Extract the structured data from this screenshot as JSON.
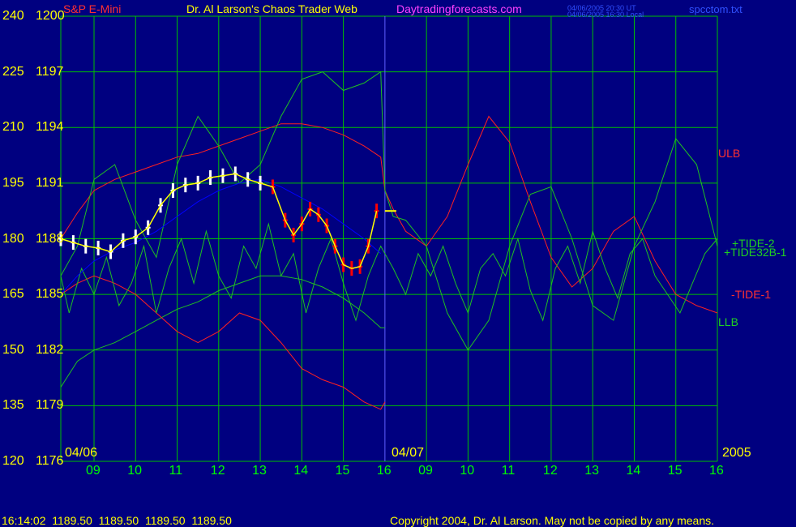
{
  "header": {
    "instrument": "S&P E-Mini",
    "title": "Dr. Al Larson's Chaos Trader Web",
    "site": "Daytradingforecasts.com",
    "ut_line": "04/06/2005 20:30 UT",
    "local_line": "04/06/2005 16:30 Local",
    "file": "spcctom.txt"
  },
  "footer": {
    "quote": "16:14:02  1189.50  1189.50  1189.50  1189.50",
    "copyright": "Copyright 2004, Dr. Al Larson. May not be copied by any means."
  },
  "colors": {
    "background": "#000080",
    "grid": "#00c000",
    "price_bars": "#ffffff",
    "price_bars_down": "#ff0000",
    "moving_avg": "#ffff00",
    "blue_band": "#0000ff",
    "ulb_llb": "#ff2020",
    "tide": "#20c020",
    "now_line": "#6060ff"
  },
  "chart_data": {
    "type": "line",
    "title": "Dr. Al Larson's Chaos Trader Web",
    "left_axis_ticks": [
      "240",
      "225",
      "210",
      "195",
      "180",
      "165",
      "150",
      "135",
      "120"
    ],
    "price_axis_ticks": [
      "1200",
      "1197",
      "1194",
      "1191",
      "1188",
      "1185",
      "1182",
      "1179",
      "1176"
    ],
    "ylim_left": [
      120,
      240
    ],
    "ylim_price": [
      1176,
      1200
    ],
    "x_ticks": [
      "09",
      "10",
      "11",
      "12",
      "13",
      "14",
      "15",
      "16",
      "09",
      "10",
      "11",
      "12",
      "13",
      "14",
      "15",
      "16"
    ],
    "date_labels": [
      "04/06",
      "04/07",
      "2005"
    ],
    "series_labels": [
      "ULB",
      "+TIDE-2",
      "+TIDE32B-1",
      "-TIDE-1",
      "LLB"
    ],
    "grid": true,
    "xlim": [
      8.2,
      24.0
    ],
    "now_x": 16.0,
    "last_price": 1189.5,
    "price_bars": {
      "x": [
        8.2,
        8.5,
        8.8,
        9.1,
        9.4,
        9.7,
        10.0,
        10.3,
        10.6,
        10.9,
        11.2,
        11.5,
        11.8,
        12.1,
        12.4,
        12.7,
        13.0,
        13.3,
        13.6,
        13.8,
        14.0,
        14.2,
        14.4,
        14.6,
        14.8,
        15.0,
        15.2,
        15.4,
        15.6,
        15.8
      ],
      "price": [
        1188.0,
        1187.8,
        1187.6,
        1187.5,
        1187.3,
        1187.9,
        1188.1,
        1188.6,
        1189.8,
        1190.6,
        1190.9,
        1191.0,
        1191.3,
        1191.4,
        1191.5,
        1191.2,
        1191.0,
        1190.8,
        1189.0,
        1188.2,
        1188.8,
        1189.6,
        1189.3,
        1188.7,
        1187.6,
        1186.6,
        1186.4,
        1186.5,
        1187.6,
        1189.5
      ],
      "red_from_index": 17
    },
    "series": [
      {
        "name": "ULB",
        "color": "#ff2020",
        "x": [
          8.2,
          8.6,
          9.0,
          9.5,
          10.0,
          10.5,
          11.0,
          11.5,
          12.0,
          12.5,
          13.0,
          13.5,
          14.0,
          14.5,
          15.0,
          15.5,
          15.9,
          16.0,
          16.2,
          16.5,
          17.0,
          17.5,
          18.0,
          18.5,
          19.0,
          19.5,
          20.0,
          20.5,
          21.0,
          21.5,
          22.0,
          22.5,
          23.0,
          23.5,
          24.0
        ],
        "y": [
          180,
          187,
          193,
          196,
          198,
          200,
          202,
          203,
          205,
          207,
          209,
          211,
          211,
          210,
          208,
          205,
          202,
          193,
          188,
          182,
          178,
          186,
          200,
          213,
          206,
          190,
          175,
          167,
          172,
          182,
          186,
          174,
          165,
          162,
          160
        ]
      },
      {
        "name": "LLB",
        "color": "#20c020",
        "x": [
          8.2,
          8.6,
          9.0,
          9.5,
          10.0,
          10.5,
          11.0,
          11.5,
          12.0,
          12.5,
          13.0,
          13.5,
          14.0,
          14.5,
          15.0,
          15.5,
          15.9,
          16.0
        ],
        "y": [
          140,
          147,
          150,
          152,
          155,
          158,
          161,
          163,
          166,
          168,
          170,
          170,
          169,
          167,
          164,
          160,
          156,
          156
        ]
      },
      {
        "name": "+TIDE-2",
        "color": "#20c020",
        "x": [
          8.2,
          8.6,
          9.0,
          9.5,
          10.0,
          10.5,
          11.0,
          11.5,
          12.0,
          12.5,
          13.0,
          13.5,
          14.0,
          14.5,
          15.0,
          15.5,
          15.9,
          16.0,
          16.2,
          16.5,
          17.0,
          17.5,
          18.0,
          18.5,
          19.0,
          19.5,
          20.0,
          20.5,
          21.0,
          21.5,
          22.0,
          22.5,
          23.0,
          23.5,
          24.0
        ],
        "y": [
          170,
          178,
          196,
          200,
          185,
          175,
          200,
          213,
          205,
          195,
          200,
          213,
          223,
          225,
          220,
          222,
          225,
          193,
          186,
          185,
          178,
          160,
          150,
          158,
          178,
          192,
          194,
          180,
          162,
          158,
          178,
          190,
          207,
          200,
          178
        ]
      },
      {
        "name": "-TIDE-1",
        "color": "#ff2020",
        "x": [
          8.2,
          8.6,
          9.0,
          9.5,
          10.0,
          10.5,
          11.0,
          11.5,
          12.0,
          12.5,
          13.0,
          13.5,
          14.0,
          14.5,
          15.0,
          15.5,
          15.9,
          16.0
        ],
        "y": [
          165,
          168,
          170,
          168,
          165,
          160,
          155,
          152,
          155,
          160,
          158,
          152,
          145,
          142,
          140,
          136,
          134,
          136
        ]
      },
      {
        "name": "+TIDE32B-1",
        "color": "#20c020",
        "x": [
          8.2,
          8.4,
          8.7,
          9.0,
          9.3,
          9.6,
          9.9,
          10.2,
          10.5,
          10.8,
          11.1,
          11.4,
          11.7,
          12.0,
          12.3,
          12.6,
          12.9,
          13.2,
          13.5,
          13.8,
          14.1,
          14.4,
          14.7,
          15.0,
          15.3,
          15.6,
          15.9,
          16.2,
          16.5,
          16.8,
          17.1,
          17.4,
          17.7,
          18.0,
          18.3,
          18.6,
          18.9,
          19.2,
          19.5,
          19.8,
          20.1,
          20.4,
          20.7,
          21.0,
          21.3,
          21.6,
          21.9,
          22.2,
          22.5,
          22.8,
          23.1,
          23.4,
          23.7,
          24.0
        ],
        "y": [
          170,
          160,
          172,
          165,
          175,
          162,
          168,
          178,
          160,
          172,
          180,
          168,
          182,
          170,
          164,
          178,
          172,
          184,
          170,
          176,
          160,
          172,
          180,
          168,
          158,
          170,
          178,
          172,
          165,
          176,
          170,
          178,
          168,
          160,
          172,
          176,
          170,
          180,
          166,
          158,
          172,
          178,
          168,
          182,
          172,
          164,
          176,
          180,
          170,
          165,
          160,
          168,
          176,
          180
        ]
      },
      {
        "name": "blue band",
        "color": "#0000ff",
        "x": [
          8.2,
          8.6,
          9.0,
          9.5,
          10.0,
          10.5,
          11.0,
          11.5,
          12.0,
          12.5,
          13.0,
          13.5,
          14.0,
          14.5,
          15.0,
          15.5,
          15.9
        ],
        "y": [
          165,
          170,
          174,
          177,
          179,
          182,
          186,
          190,
          193,
          195,
          196,
          194,
          191,
          188,
          184,
          180,
          176
        ]
      }
    ]
  }
}
